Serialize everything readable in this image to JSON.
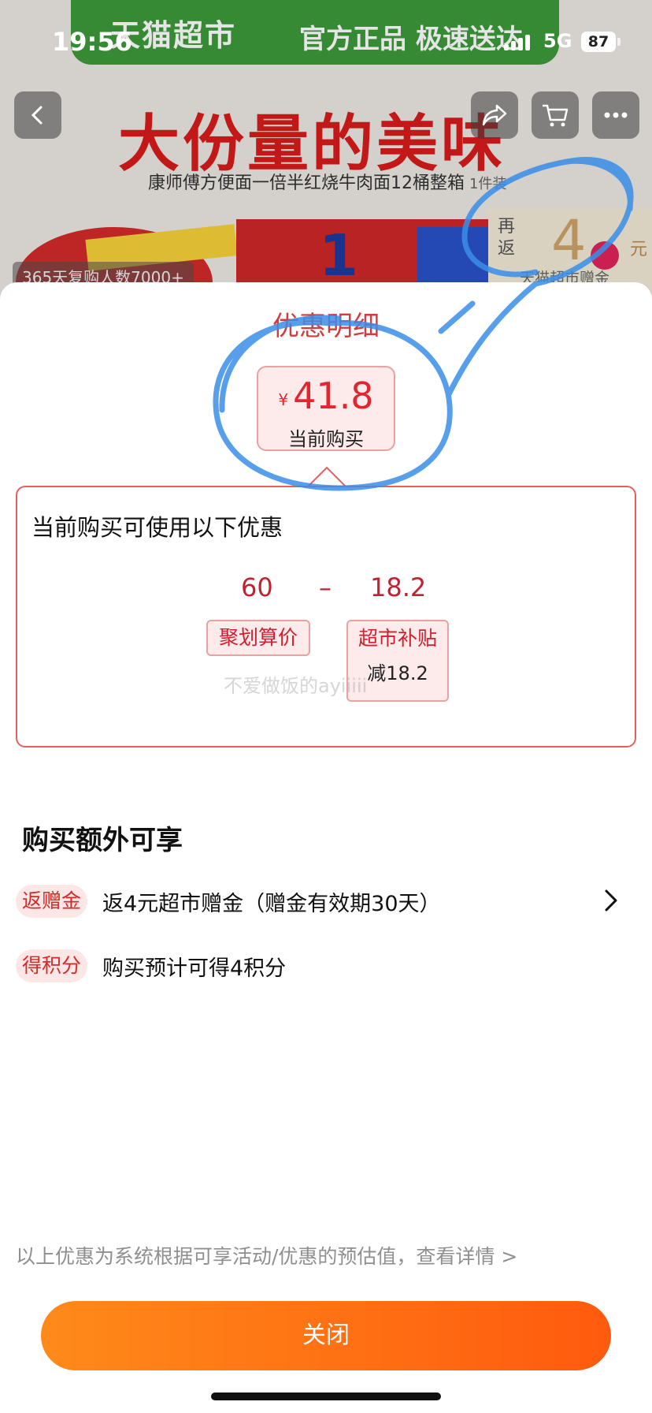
{
  "status_bar": {
    "time": "19:56",
    "network": "5G",
    "battery": "87"
  },
  "background": {
    "banner_brand": "天猫超市",
    "banner_slogan": "官方正品 极速送达",
    "headline": "大份量的美味",
    "product_name": "康师傅方便面一倍半红烧牛肉面12桶整箱",
    "product_unit": "1件装",
    "product_number": "1",
    "promo_prefix": "再返",
    "promo_amount": "4",
    "promo_unit": "元",
    "promo_label": "天猫超市赠金",
    "repurchase_badge": "365天复购人数7000+"
  },
  "nav": {
    "back_icon": "chevron-left-icon",
    "share_icon": "share-icon",
    "cart_icon": "cart-icon",
    "more_icon": "more-icon"
  },
  "sheet": {
    "title": "优惠明细",
    "price": {
      "currency": "¥",
      "amount": "41.8",
      "label": "当前购买"
    },
    "detail": {
      "heading": "当前购买可使用以下优惠",
      "base_value": "60",
      "operator": "–",
      "discount_value": "18.2",
      "tag1": "聚划算价",
      "tag2_title": "超市补贴",
      "tag2_sub": "减18.2",
      "watermark": "不爱做饭的ayiiiii"
    },
    "extra": {
      "title": "购买额外可享",
      "rows": [
        {
          "chip": "返赠金",
          "desc": "返4元超市赠金（赠金有效期30天）",
          "has_arrow": true
        },
        {
          "chip": "得积分",
          "desc": "购买预计可得4积分",
          "has_arrow": false
        }
      ]
    },
    "footnote": "以上优惠为系统根据可享活动/优惠的预估值，查看详情 >",
    "close_label": "关闭"
  },
  "colors": {
    "accent_red": "#e0262e",
    "button_orange": "#ff6a12",
    "annotation_blue": "#3a8ee8"
  }
}
